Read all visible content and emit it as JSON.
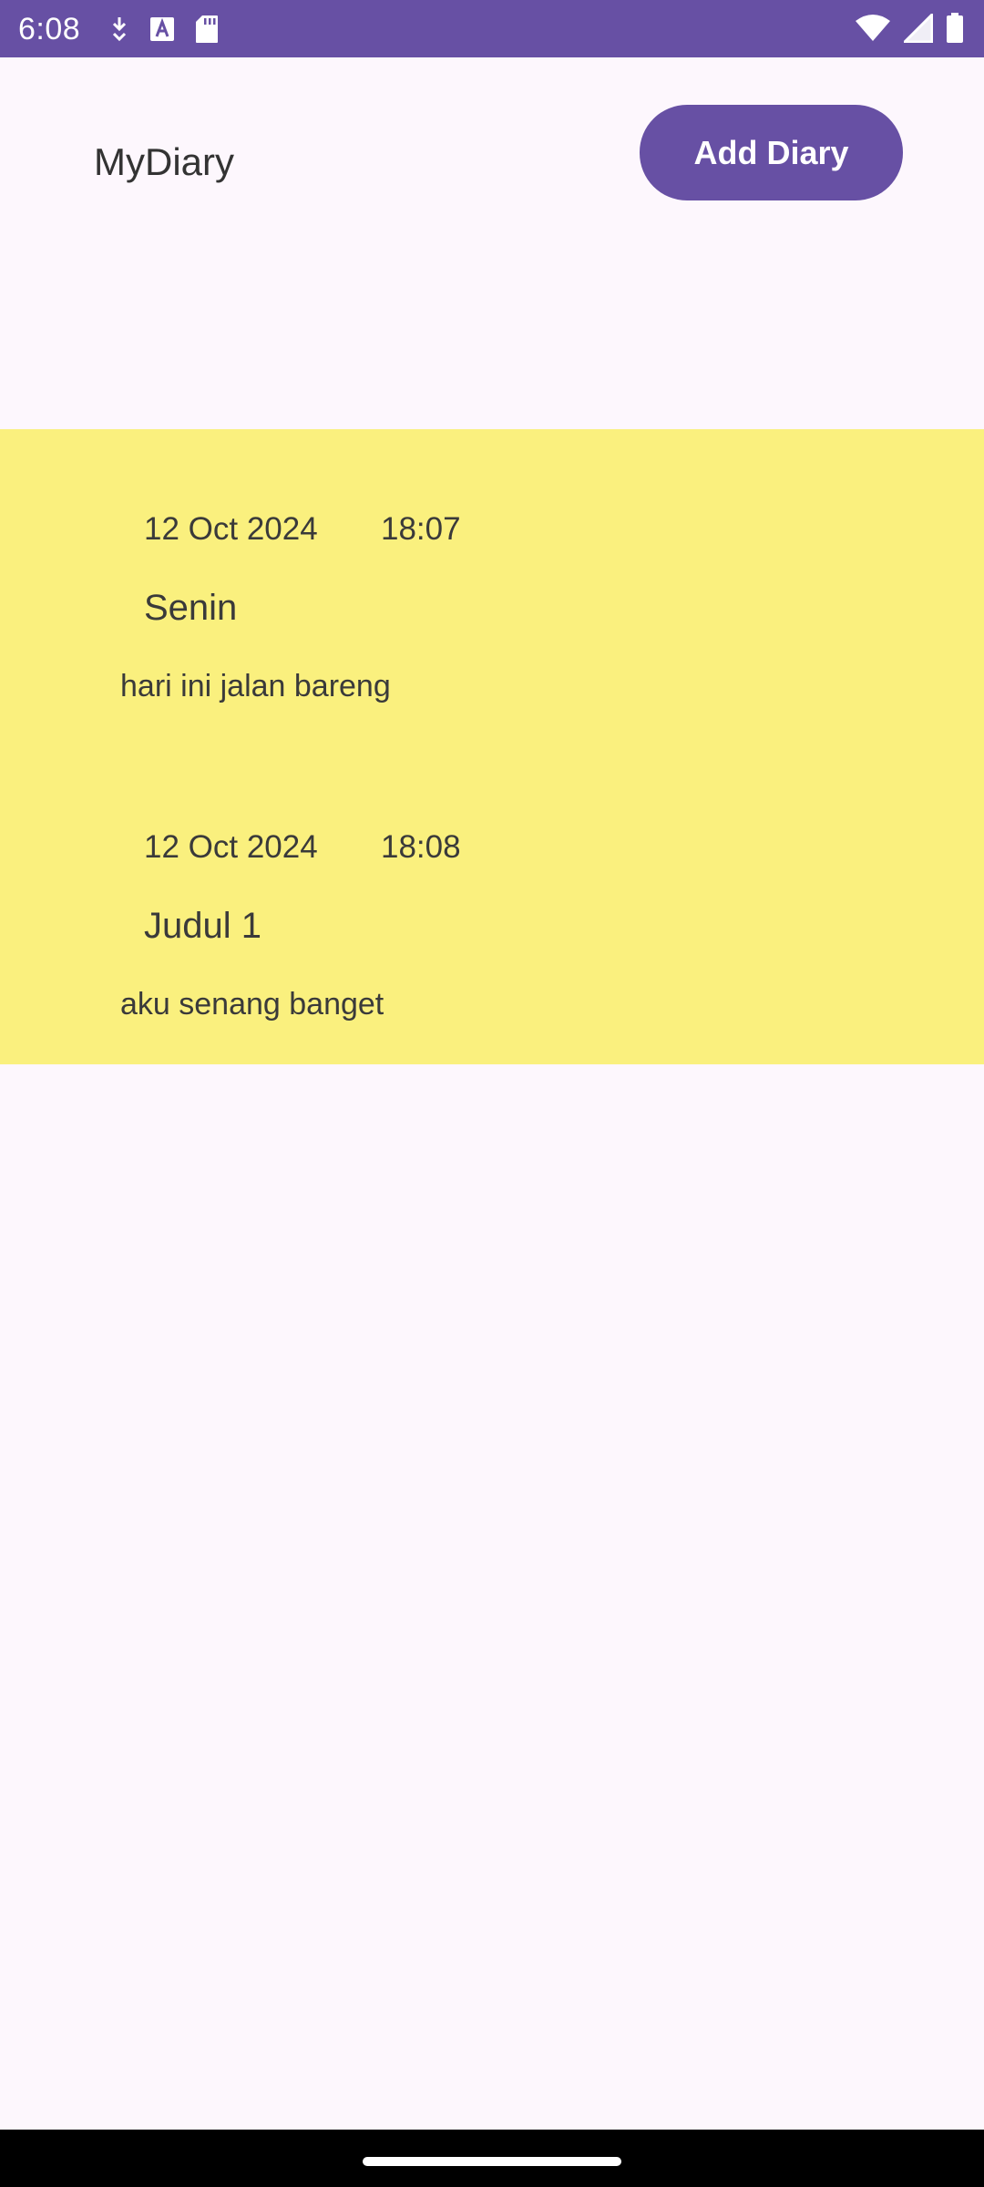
{
  "status_bar": {
    "time": "6:08",
    "left_icons": [
      "download-arrow-icon",
      "text-a-icon",
      "sd-card-icon"
    ],
    "right_icons": [
      "wifi-icon",
      "cell-signal-icon",
      "battery-icon"
    ],
    "color": "#6750a4"
  },
  "header": {
    "title": "MyDiary",
    "add_button_label": "Add Diary",
    "accent_color": "#6750a4"
  },
  "diary": {
    "background_color": "#faf07e",
    "entries": [
      {
        "date": "12 Oct 2024",
        "time": "18:07",
        "title": "Senin",
        "content": "hari ini jalan bareng"
      },
      {
        "date": "12 Oct 2024",
        "time": "18:08",
        "title": "Judul 1",
        "content": "aku senang banget"
      }
    ]
  }
}
